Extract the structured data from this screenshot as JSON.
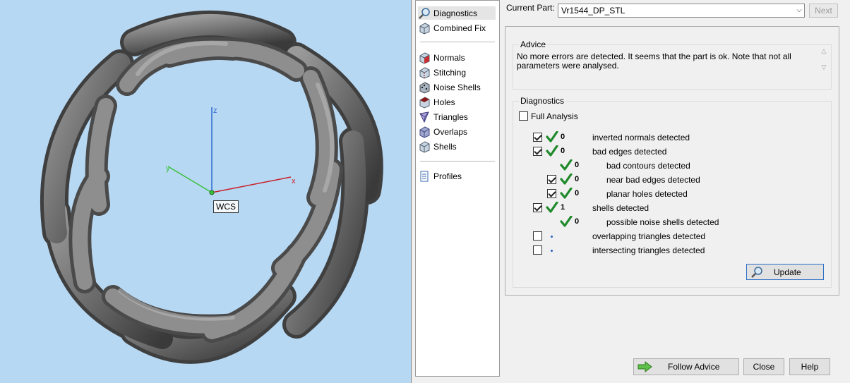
{
  "viewport": {
    "axis_x": "x",
    "axis_y": "y",
    "axis_z": "z",
    "wcs_label": "WCS"
  },
  "nav": {
    "items": [
      {
        "label": "Diagnostics",
        "icon": "magnifier-icon",
        "active": true
      },
      {
        "label": "Combined Fix",
        "icon": "cube-icon"
      },
      {
        "label": "Normals",
        "icon": "cube-red-face-icon"
      },
      {
        "label": "Stitching",
        "icon": "cube-stitch-icon"
      },
      {
        "label": "Noise Shells",
        "icon": "cube-noise-icon"
      },
      {
        "label": "Holes",
        "icon": "cube-hole-icon"
      },
      {
        "label": "Triangles",
        "icon": "triangle-icon"
      },
      {
        "label": "Overlaps",
        "icon": "overlap-icon"
      },
      {
        "label": "Shells",
        "icon": "cube-icon"
      },
      {
        "label": "Profiles",
        "icon": "document-icon"
      }
    ]
  },
  "header": {
    "current_part_label": "Current Part:",
    "current_part_value": "Vr1544_DP_STL",
    "next_label": "Next"
  },
  "advice": {
    "title": "Advice",
    "text": "No more errors are detected. It seems that the part is ok. Note that not all parameters were analysed."
  },
  "diagnostics": {
    "title": "Diagnostics",
    "full_analysis_label": "Full Analysis",
    "rows": [
      {
        "checkbox": true,
        "checked": true,
        "status": "check",
        "count": "0",
        "label": "inverted normals detected",
        "indent": 0
      },
      {
        "checkbox": true,
        "checked": true,
        "status": "check",
        "count": "0",
        "label": "bad edges detected",
        "indent": 0
      },
      {
        "checkbox": false,
        "checked": false,
        "status": "check",
        "count": "0",
        "label": "bad contours detected",
        "indent": 1
      },
      {
        "checkbox": true,
        "checked": true,
        "status": "check",
        "count": "0",
        "label": "near bad edges detected",
        "indent": 1
      },
      {
        "checkbox": true,
        "checked": true,
        "status": "check",
        "count": "0",
        "label": "planar holes detected",
        "indent": 1
      },
      {
        "checkbox": true,
        "checked": true,
        "status": "check",
        "count": "1",
        "label": "shells detected",
        "indent": 0
      },
      {
        "checkbox": false,
        "checked": false,
        "status": "check",
        "count": "0",
        "label": "possible noise shells detected",
        "indent": 1
      },
      {
        "checkbox": true,
        "checked": false,
        "status": "dot",
        "count": "",
        "label": "overlapping triangles detected",
        "indent": 0
      },
      {
        "checkbox": true,
        "checked": false,
        "status": "dot",
        "count": "",
        "label": "intersecting triangles detected",
        "indent": 0
      }
    ],
    "update_label": "Update"
  },
  "footer": {
    "follow_advice_label": "Follow Advice",
    "close_label": "Close",
    "help_label": "Help"
  },
  "colors": {
    "viewport_bg": "#b7d8f3",
    "check_green": "#1f8a2a",
    "axis_x": "#c8202a",
    "axis_y": "#3cc03c",
    "axis_z": "#2a6ad0"
  }
}
